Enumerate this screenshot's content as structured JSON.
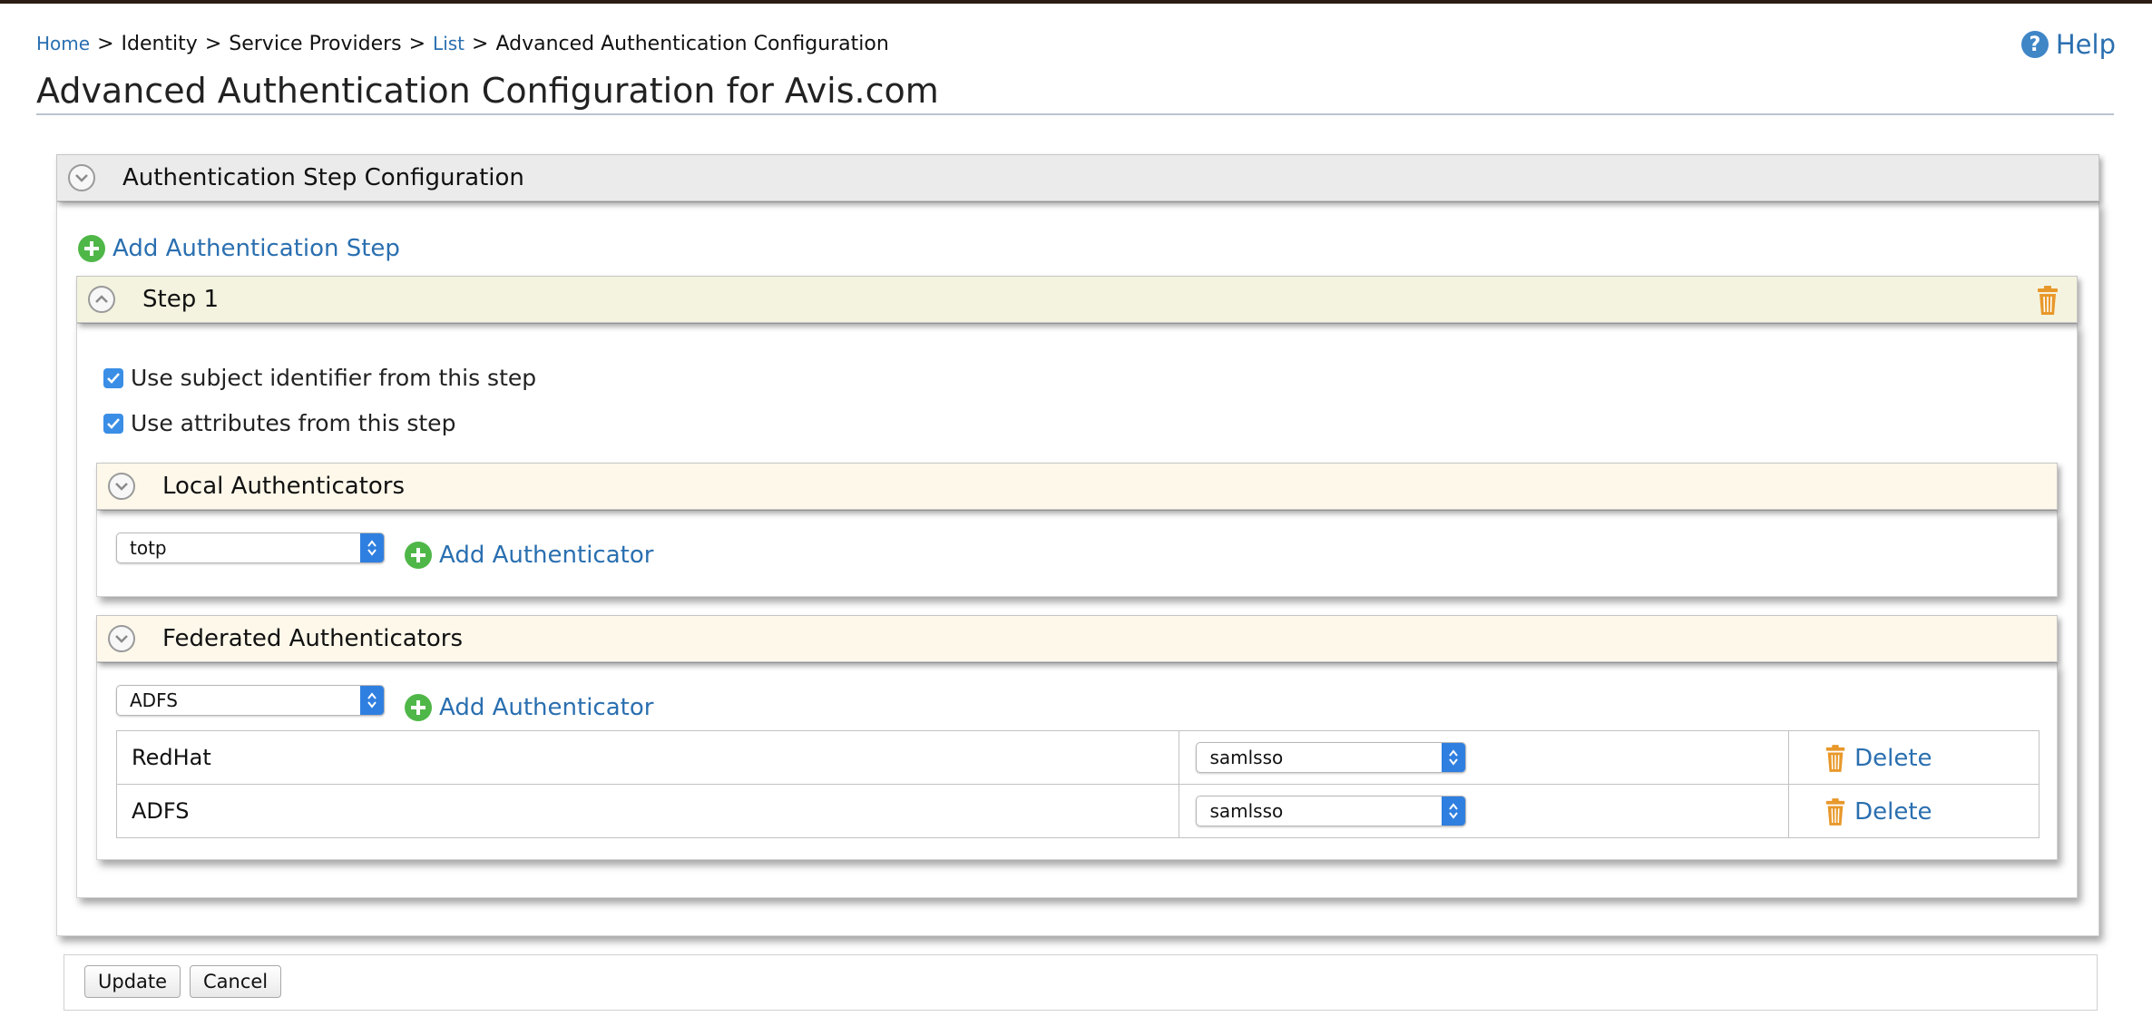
{
  "breadcrumb": {
    "home": "Home",
    "identity": "Identity",
    "service_providers": "Service Providers",
    "list": "List",
    "current": "Advanced Authentication Configuration",
    "separator": ">"
  },
  "help_label": "Help",
  "page_title": "Advanced Authentication Configuration for Avis.com",
  "auth_step_config": {
    "title": "Authentication Step Configuration",
    "add_step_label": "Add Authentication Step"
  },
  "step": {
    "title": "Step 1",
    "use_subject_label": "Use subject identifier from this step",
    "use_subject_checked": true,
    "use_attributes_label": "Use attributes from this step",
    "use_attributes_checked": true
  },
  "local_authenticators": {
    "title": "Local Authenticators",
    "selected": "totp",
    "add_label": "Add Authenticator"
  },
  "federated_authenticators": {
    "title": "Federated Authenticators",
    "selected": "ADFS",
    "add_label": "Add Authenticator",
    "rows": [
      {
        "name": "RedHat",
        "protocol": "samlsso",
        "delete_label": "Delete"
      },
      {
        "name": "ADFS",
        "protocol": "samlsso",
        "delete_label": "Delete"
      }
    ]
  },
  "footer": {
    "update_label": "Update",
    "cancel_label": "Cancel"
  },
  "colors": {
    "link": "#2a6fb0",
    "section_gray": "#ebebeb",
    "step_bar": "#f4f3df",
    "sub_bar": "#fdf8ea",
    "select_accent": "#2f7fe0",
    "add_icon": "#4fb748",
    "trash_icon": "#e8982a"
  },
  "icons": {
    "help": "question-circle-icon",
    "add": "plus-circle-icon",
    "delete": "trash-icon",
    "collapse": "chevron-down-icon",
    "expand": "chevron-up-icon",
    "select": "select-arrows-icon"
  }
}
